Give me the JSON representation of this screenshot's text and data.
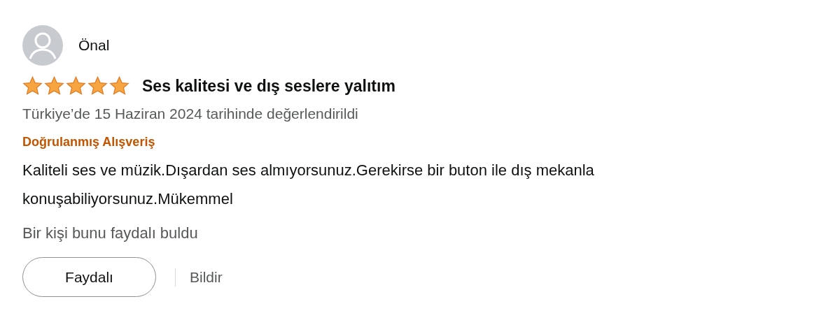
{
  "review": {
    "author": "Önal",
    "stars": 5,
    "title": "Ses kalitesi ve dış seslere yalıtım",
    "date": "Türkiye’de 15 Haziran 2024 tarihinde değerlendirildi",
    "verified": "Doğrulanmış Alışveriş",
    "body": "Kaliteli ses ve müzik.Dışardan ses almıyorsunuz.Gerekirse bir buton ile dış mekanla konuşabiliyorsunuz.Mükemmel",
    "helpful_count": "Bir kişi bunu faydalı buldu"
  },
  "buttons": {
    "helpful": "Faydalı",
    "report": "Bildir"
  }
}
